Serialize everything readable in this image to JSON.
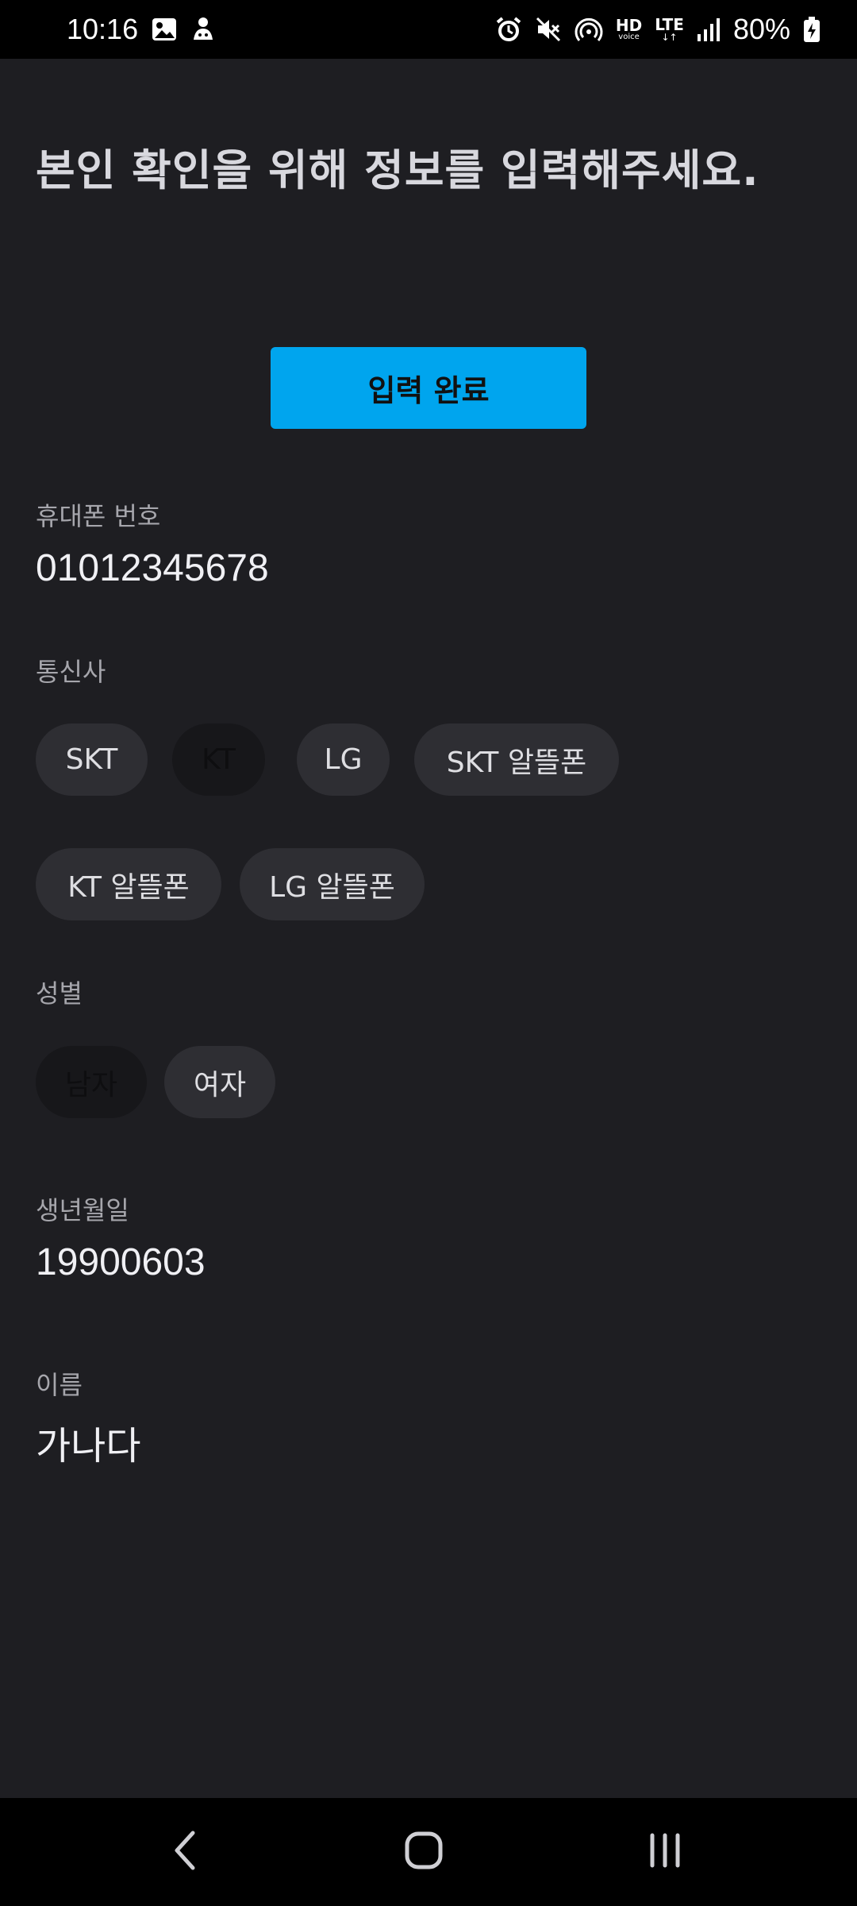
{
  "status_bar": {
    "time": "10:16",
    "hd_big": "HD",
    "hd_small": "voice",
    "lte_big": "LTE",
    "lte_small": "↓↑",
    "battery_percent": "80%"
  },
  "page": {
    "title": "본인 확인을 위해 정보를 입력해주세요.",
    "submit_label": "입력 완료"
  },
  "fields": {
    "phone_label": "휴대폰 번호",
    "phone_value": "01012345678",
    "carrier_label": "통신사",
    "carriers": [
      {
        "label": "SKT",
        "selected": false
      },
      {
        "label": "KT",
        "selected": true
      },
      {
        "label": "LG",
        "selected": false
      },
      {
        "label": "SKT 알뜰폰",
        "selected": false
      },
      {
        "label": "KT 알뜰폰",
        "selected": false
      },
      {
        "label": "LG 알뜰폰",
        "selected": false
      }
    ],
    "gender_label": "성별",
    "genders": [
      {
        "label": "남자",
        "selected": true
      },
      {
        "label": "여자",
        "selected": false
      }
    ],
    "birth_label": "생년월일",
    "birth_value": "19900603",
    "name_label": "이름",
    "name_value": "가나다"
  },
  "colors": {
    "accent": "#00a5ee",
    "background": "#1e1e22",
    "chip": "#2e2e33",
    "chip_selected": "#17171a"
  },
  "nav": {
    "back_icon": "back-chevron-icon",
    "home_icon": "home-icon",
    "recents_icon": "recent-apps-icon"
  }
}
